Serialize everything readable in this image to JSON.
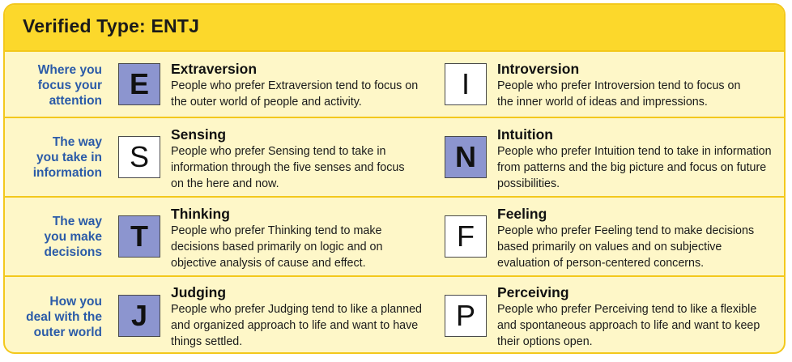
{
  "title": "Verified Type: ENTJ",
  "rows": [
    {
      "label": [
        "Where you",
        "focus your",
        "attention"
      ],
      "left": {
        "letter": "E",
        "selected": true,
        "name": "Extraversion",
        "desc": [
          "People who prefer Extraversion tend to focus on",
          "the outer world of people and activity."
        ]
      },
      "right": {
        "letter": "I",
        "selected": false,
        "name": "Introversion",
        "desc": [
          "People who prefer Introversion tend to focus on",
          "the inner world of ideas and impressions."
        ]
      }
    },
    {
      "label": [
        "The way",
        "you take in",
        "information"
      ],
      "left": {
        "letter": "S",
        "selected": false,
        "name": "Sensing",
        "desc": [
          "People who prefer Sensing tend to take in",
          "information through the five senses and focus",
          "on the here and now."
        ]
      },
      "right": {
        "letter": "N",
        "selected": true,
        "name": "Intuition",
        "desc": [
          "People who prefer Intuition tend to take in information",
          "from patterns and the big picture and focus on future",
          "possibilities."
        ]
      }
    },
    {
      "label": [
        "The way",
        "you make",
        "decisions"
      ],
      "left": {
        "letter": "T",
        "selected": true,
        "name": "Thinking",
        "desc": [
          "People who prefer Thinking tend to make",
          "decisions based primarily on logic and on",
          "objective analysis of cause and effect."
        ]
      },
      "right": {
        "letter": "F",
        "selected": false,
        "name": "Feeling",
        "desc": [
          "People who prefer Feeling tend to make decisions",
          "based primarily on values and on subjective",
          "evaluation of person-centered concerns."
        ]
      }
    },
    {
      "label": [
        "How you",
        "deal with the",
        "outer world"
      ],
      "left": {
        "letter": "J",
        "selected": true,
        "name": "Judging",
        "desc": [
          "People who prefer Judging tend to like a planned",
          "and organized approach to life and want to have",
          "things settled."
        ]
      },
      "right": {
        "letter": "P",
        "selected": false,
        "name": "Perceiving",
        "desc": [
          "People who prefer Perceiving tend to like a flexible",
          "and spontaneous approach to life and want to keep",
          "their options open."
        ]
      }
    }
  ]
}
